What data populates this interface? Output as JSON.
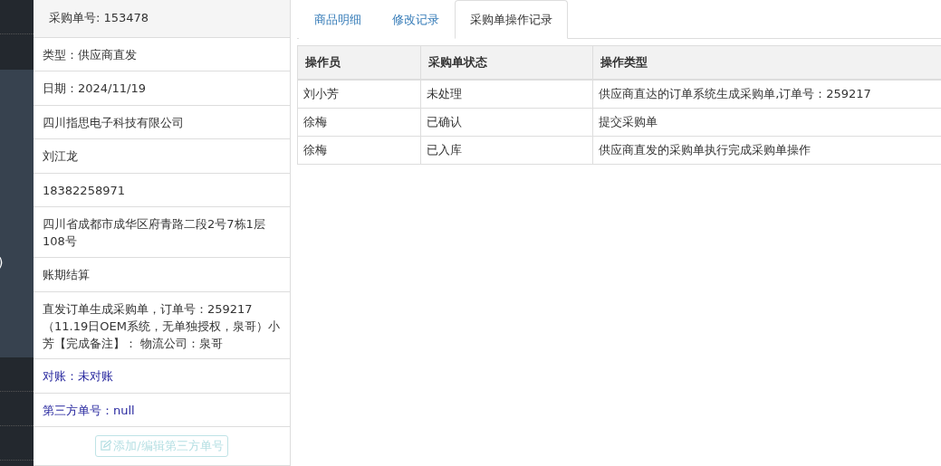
{
  "sidebar": {
    "fragment": ")"
  },
  "order_panel": {
    "header": "采购单号: 153478",
    "rows": [
      {
        "kind": "plain",
        "text": "类型：供应商直发"
      },
      {
        "kind": "plain",
        "text": "日期：2024/11/19"
      },
      {
        "kind": "plain",
        "text": "四川指思电子科技有限公司"
      },
      {
        "kind": "plain",
        "text": "刘江龙"
      },
      {
        "kind": "plain",
        "text": "18382258971"
      },
      {
        "kind": "plain",
        "text": "四川省成都市成华区府青路二段2号7栋1层108号"
      },
      {
        "kind": "plain",
        "text": "账期结算"
      },
      {
        "kind": "plain",
        "text": "直发订单生成采购单，订单号：259217 （11.19日OEM系统，无单独授权，泉哥）小芳【完成备注】： 物流公司：泉哥"
      },
      {
        "kind": "accent",
        "text": "对账：未对账"
      },
      {
        "kind": "accent",
        "text": "第三方单号：null"
      }
    ],
    "button": {
      "label": "添加/编辑第三方单号",
      "disabled": true
    }
  },
  "tabs": [
    {
      "label": "商品明细",
      "selected": false
    },
    {
      "label": "修改记录",
      "selected": false
    },
    {
      "label": "采购单操作记录",
      "selected": true
    }
  ],
  "table": {
    "columns": [
      "操作员",
      "采购单状态",
      "操作类型"
    ],
    "rows": [
      [
        "刘小芳",
        "未处理",
        "供应商直达的订单系统生成采购单,订单号：259217"
      ],
      [
        "徐梅",
        "已确认",
        "提交采购单"
      ],
      [
        "徐梅",
        "已入库",
        "供应商直发的采购单执行完成采购单操作"
      ]
    ]
  }
}
